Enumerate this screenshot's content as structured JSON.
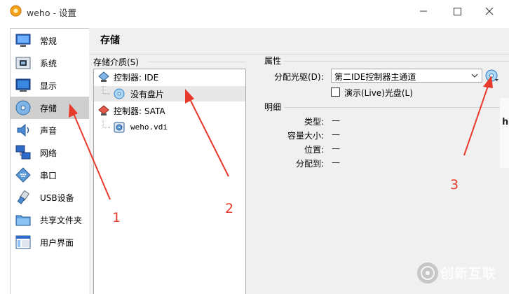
{
  "window": {
    "title": "weho - 设置",
    "minimize_icon": "minimize-icon",
    "maximize_icon": "maximize-icon",
    "close_icon": "close-icon"
  },
  "sidebar": {
    "items": [
      {
        "label": "常规",
        "icon": "general-monitor-icon"
      },
      {
        "label": "系统",
        "icon": "system-chip-icon"
      },
      {
        "label": "显示",
        "icon": "display-monitor-icon"
      },
      {
        "label": "存储",
        "icon": "storage-disk-icon",
        "active": true
      },
      {
        "label": "声音",
        "icon": "speaker-icon"
      },
      {
        "label": "网络",
        "icon": "network-icon"
      },
      {
        "label": "串口",
        "icon": "serial-port-icon"
      },
      {
        "label": "USB设备",
        "icon": "usb-icon"
      },
      {
        "label": "共享文件夹",
        "icon": "shared-folder-icon"
      },
      {
        "label": "用户界面",
        "icon": "user-interface-icon"
      }
    ]
  },
  "main": {
    "title": "存储",
    "storage_media_label": "存储介质(S)",
    "tree": [
      {
        "label": "控制器: IDE",
        "icon": "ide-controller-icon",
        "level": 0
      },
      {
        "label": "没有盘片",
        "icon": "empty-optical-disk-icon",
        "level": 1,
        "selected": true
      },
      {
        "label": "控制器: SATA",
        "icon": "sata-controller-icon",
        "level": 0
      },
      {
        "label": "weho.vdi",
        "icon": "hard-disk-icon",
        "level": 1
      }
    ],
    "attributes": {
      "group_label": "属性",
      "drive_label": "分配光驱(D):",
      "drive_value": "第二IDE控制器主通道",
      "live_cd_label": "演示(Live)光盘(L)",
      "live_cd_checked": false,
      "choose_disk_icon": "optical-disk-choose-icon"
    },
    "details": {
      "group_label": "明细",
      "rows": [
        {
          "key": "类型:",
          "value": "—"
        },
        {
          "key": "容量大小:",
          "value": "—"
        },
        {
          "key": "位置:",
          "value": "—"
        },
        {
          "key": "分配到:",
          "value": "—"
        }
      ]
    }
  },
  "annotations": {
    "labels": [
      "1",
      "2",
      "3"
    ],
    "color": "#e83a2c"
  },
  "edge_text": "h",
  "watermark": {
    "text": "创新互联"
  },
  "colors": {
    "sidebar_active": "#cfcfcf",
    "panel_bg": "#f0f0f0",
    "tree_selected": "#e8e8e8",
    "annotation": "#e83a2c"
  }
}
